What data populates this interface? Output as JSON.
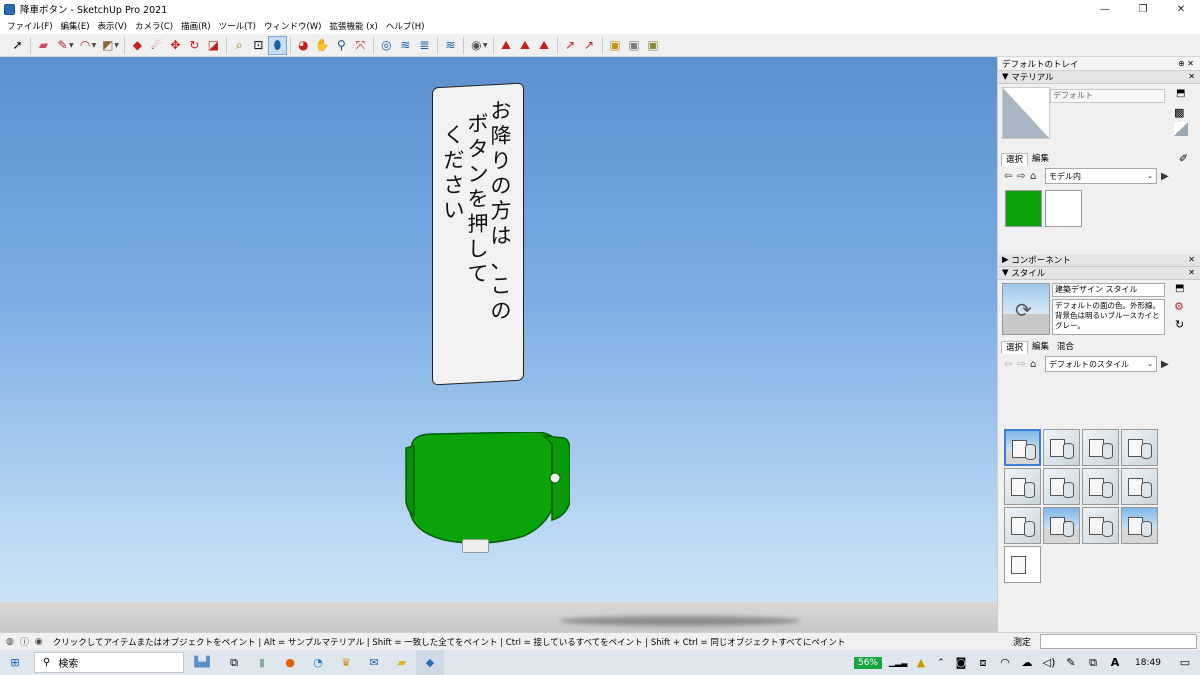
{
  "window": {
    "title": "降車ボタン - SketchUp Pro 2021",
    "minimize": "—",
    "maximize": "❐",
    "close": "✕"
  },
  "menu": [
    "ファイル(F)",
    "編集(E)",
    "表示(V)",
    "カメラ(C)",
    "描画(R)",
    "ツール(T)",
    "ウィンドウ(W)",
    "拡張機能 (x)",
    "ヘルプ(H)"
  ],
  "sign": {
    "columns": [
      [
        "お",
        "降",
        "り",
        "の",
        "方",
        "は",
        "、",
        "こ",
        "の"
      ],
      [
        "ボ",
        "タ",
        "ン",
        "を",
        "押",
        "し",
        "て"
      ],
      [
        "く",
        "だ",
        "さ",
        "い"
      ]
    ]
  },
  "tray": {
    "title": "デフォルトのトレイ",
    "materials": {
      "header": "マテリアル",
      "name": "デフォルト",
      "tabs": [
        "選択",
        "編集"
      ],
      "dropdown": "モデル内"
    },
    "components": {
      "header": "コンポーネント"
    },
    "styles": {
      "header": "スタイル",
      "name": "建築デザイン スタイル",
      "description": "デフォルトの面の色。外形線。背景色は明るいブルースカイとグレー。",
      "tabs": [
        "選択",
        "編集",
        "混合"
      ],
      "dropdown": "デフォルトのスタイル"
    }
  },
  "status": {
    "message": "クリックしてアイテムまたはオブジェクトをペイント | Alt = サンプルマテリアル | Shift = 一致した全てをペイント | Ctrl = 接しているすべてをペイント | Shift + Ctrl = 同じオブジェクトすべてにペイント",
    "measure_label": "測定"
  },
  "taskbar": {
    "search": "検索",
    "battery": "56%",
    "time": "18:49"
  },
  "colors": {
    "green": "#0aa30a",
    "sky": "#6fa3dd"
  }
}
